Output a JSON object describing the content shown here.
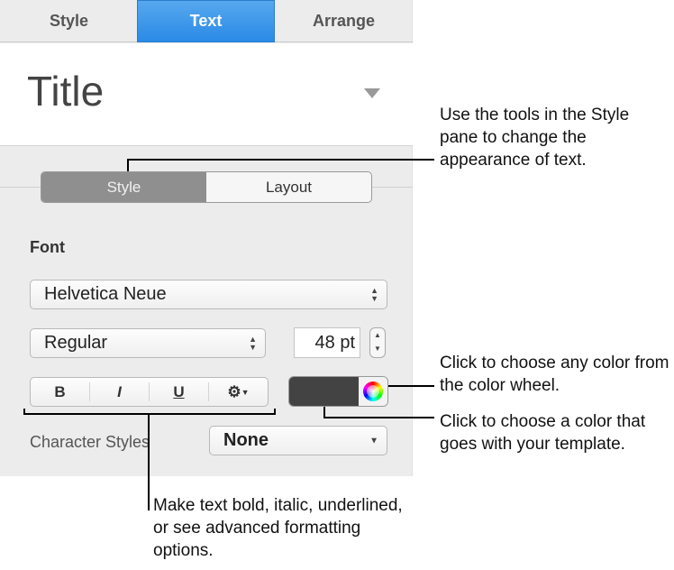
{
  "tabs": [
    {
      "label": "Style"
    },
    {
      "label": "Text"
    },
    {
      "label": "Arrange"
    }
  ],
  "paragraph_style": "Title",
  "segments": [
    {
      "label": "Style"
    },
    {
      "label": "Layout"
    }
  ],
  "font_label": "Font",
  "font_family": "Helvetica Neue",
  "font_typeface": "Regular",
  "font_size": "48 pt",
  "format_buttons": {
    "bold": "B",
    "italic": "I",
    "underline": "U"
  },
  "text_color": "#434343",
  "character_styles_label": "Character Styles",
  "character_style": "None",
  "callouts": {
    "style_pane": "Use the tools in the Style pane to change the appearance of text.",
    "color_wheel": "Click to choose any color from the color wheel.",
    "color_well": "Click to choose a color that goes with your template.",
    "format": "Make text bold, italic, underlined, or see advanced formatting options."
  }
}
